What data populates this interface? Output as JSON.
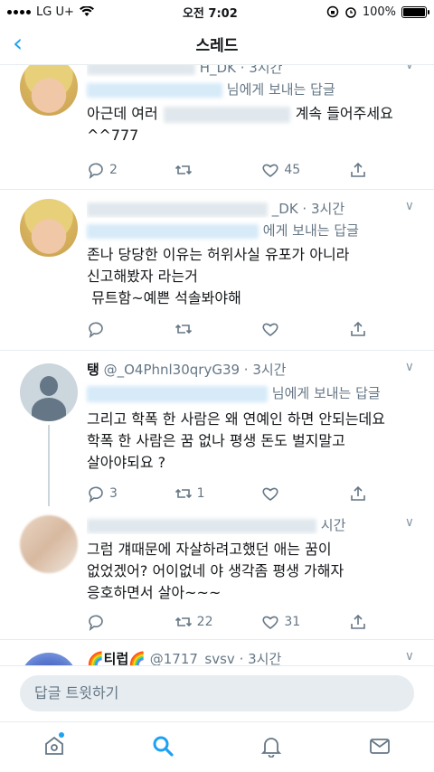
{
  "status_bar": {
    "carrier": "LG U+",
    "time": "오전 7:02",
    "battery": "100%"
  },
  "nav": {
    "title": "스레드"
  },
  "tweets": [
    {
      "handle_tail": "H_DK · 3시간",
      "reply_suffix": "님에게 보내는 답글",
      "text": "아근데 여러",
      "text_after": "계속 들어주세요\n^^777",
      "replies": "2",
      "retweets": "",
      "likes": "45"
    },
    {
      "handle_tail": "_DK · 3시간",
      "reply_suffix": "에게 보내는 답글",
      "text": "존나 당당한 이유는 허위사실 유포가 아니라\n신고해봤자 라는거\n 뮤트함~예쁜 석솔봐야해",
      "replies": "",
      "retweets": "",
      "likes": ""
    },
    {
      "name": "탱",
      "handle_tail": "@_O4Phnl30qryG39 · 3시간",
      "reply_suffix": "님에게 보내는 답글",
      "text": "그리고 학폭 한 사람은 왜 연예인 하면 안되는데요\n학폭 한 사람은 꿈 없나 평생 돈도 벌지말고\n살아야되요 ?",
      "replies": "3",
      "retweets": "1",
      "likes": ""
    },
    {
      "handle_tail": "시간",
      "text": "그럼 걔때문에 자살하려고했던 애는 꿈이\n없었겠어? 어이없네 야 생각좀 평생 가해자\n응호하면서 살아~~~",
      "replies": "",
      "retweets": "22",
      "likes": "31"
    },
    {
      "name": "🌈티럽🌈",
      "handle_tail": "@1717_svsv · 3시간"
    }
  ],
  "composer": {
    "placeholder": "답글 트윗하기"
  },
  "tabs": [
    "home",
    "search",
    "notifications",
    "messages"
  ]
}
